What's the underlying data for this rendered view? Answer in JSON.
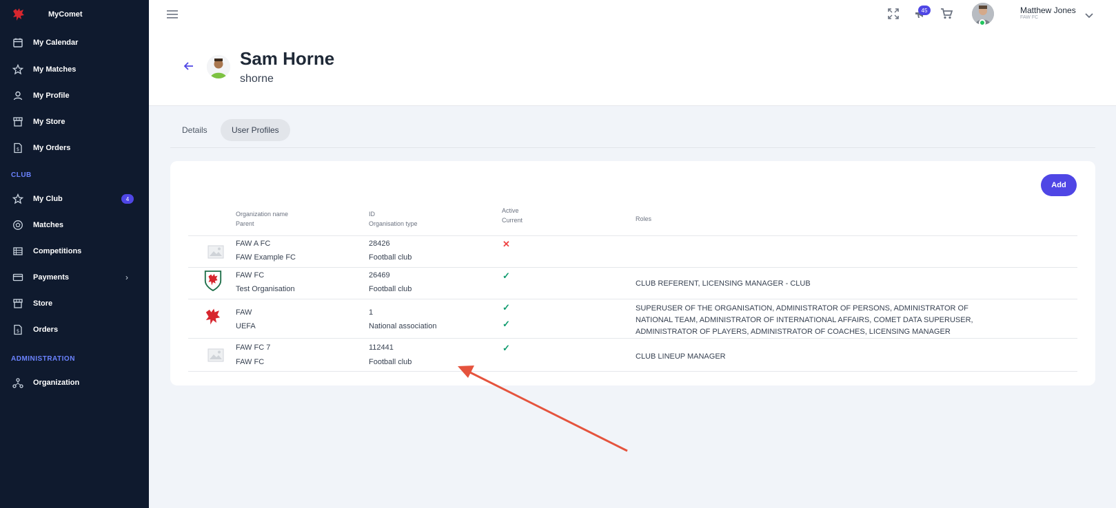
{
  "app": {
    "name": "MyComet"
  },
  "sidebar": {
    "personal": [
      {
        "label": "My Calendar",
        "icon": "calendar-icon"
      },
      {
        "label": "My Matches",
        "icon": "star-icon"
      },
      {
        "label": "My Profile",
        "icon": "person-icon"
      },
      {
        "label": "My Store",
        "icon": "store-icon"
      },
      {
        "label": "My Orders",
        "icon": "orders-icon"
      }
    ],
    "club_title": "CLUB",
    "club": [
      {
        "label": "My Club",
        "icon": "star-icon",
        "badge": "4"
      },
      {
        "label": "Matches",
        "icon": "ball-icon"
      },
      {
        "label": "Competitions",
        "icon": "list-icon"
      },
      {
        "label": "Payments",
        "icon": "card-icon",
        "chevron": "›"
      },
      {
        "label": "Store",
        "icon": "store-icon"
      },
      {
        "label": "Orders",
        "icon": "orders-icon"
      }
    ],
    "admin_title": "ADMINISTRATION",
    "admin": [
      {
        "label": "Organization",
        "icon": "hierarchy-icon"
      }
    ]
  },
  "topbar": {
    "notifications_count": "45",
    "user_name": "Matthew Jones",
    "user_club": "FAW FC"
  },
  "person": {
    "name": "Sam Horne",
    "username": "shorne"
  },
  "tabs": [
    {
      "label": "Details",
      "active": false
    },
    {
      "label": "User Profiles",
      "active": true
    }
  ],
  "table": {
    "add_label": "Add",
    "headers": {
      "org_name": "Organization name",
      "parent": "Parent",
      "id": "ID",
      "org_type": "Organisation type",
      "active": "Active",
      "current": "Current",
      "roles": "Roles"
    },
    "rows": [
      {
        "org": "FAW A FC",
        "parent": "FAW Example FC",
        "id": "28426",
        "type": "Football club",
        "active": "no",
        "current": "",
        "roles": "",
        "logo": "placeholder-image-icon"
      },
      {
        "org": "FAW FC",
        "parent": "Test Organisation",
        "id": "26469",
        "type": "Football club",
        "active": "yes",
        "current": "",
        "roles": "CLUB REFERENT, LICENSING MANAGER - CLUB",
        "logo": "faw-fc-crest-icon"
      },
      {
        "org": "FAW",
        "parent": "UEFA",
        "id": "1",
        "type": "National association",
        "active": "yes",
        "current": "yes",
        "roles": "SUPERUSER OF THE ORGANISATION, ADMINISTRATOR OF PERSONS, ADMINISTRATOR OF NATIONAL TEAM, ADMINISTRATOR OF INTERNATIONAL AFFAIRS, COMET DATA SUPERUSER, ADMINISTRATOR OF PLAYERS, ADMINISTRATOR OF COACHES, LICENSING MANAGER",
        "logo": "faw-dragon-icon"
      },
      {
        "org": "FAW FC 7",
        "parent": "FAW FC",
        "id": "112441",
        "type": "Football club",
        "active": "yes",
        "current": "",
        "roles": "CLUB LINEUP MANAGER",
        "logo": "placeholder-image-icon"
      }
    ]
  },
  "colors": {
    "sidebar_bg": "#0f1a2e",
    "accent": "#4f46e5",
    "check": "#0f9b6e",
    "cross": "#ef4444",
    "annotation": "#e5533d"
  }
}
